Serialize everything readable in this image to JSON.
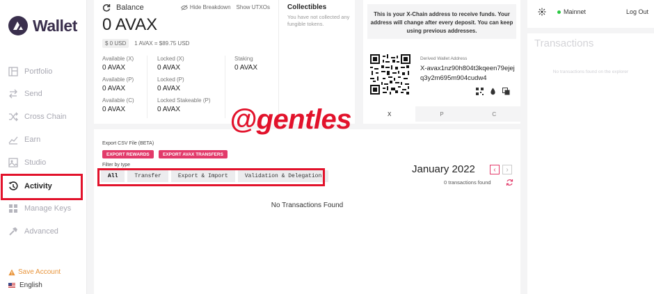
{
  "app": {
    "name": "Wallet"
  },
  "sidebar": {
    "items": [
      {
        "label": "Portfolio",
        "icon": "portfolio-icon"
      },
      {
        "label": "Send",
        "icon": "send-icon"
      },
      {
        "label": "Cross Chain",
        "icon": "cross-chain-icon"
      },
      {
        "label": "Earn",
        "icon": "earn-icon"
      },
      {
        "label": "Studio",
        "icon": "studio-icon"
      },
      {
        "label": "Activity",
        "icon": "activity-icon",
        "active": true
      },
      {
        "label": "Manage Keys",
        "icon": "manage-keys-icon"
      },
      {
        "label": "Advanced",
        "icon": "advanced-icon"
      }
    ],
    "save_account": "Save Account",
    "language": "English"
  },
  "balance": {
    "title": "Balance",
    "hide_breakdown": "Hide Breakdown",
    "show_utxos": "Show UTXOs",
    "amount": "0 AVAX",
    "usd": "$ 0 USD",
    "rate": "1 AVAX = $89.75 USD",
    "stats": [
      {
        "label": "Available (X)",
        "value": "0 AVAX"
      },
      {
        "label": "Available (P)",
        "value": "0 AVAX"
      },
      {
        "label": "Available (C)",
        "value": "0 AVAX"
      },
      {
        "label": "Locked (X)",
        "value": "0 AVAX"
      },
      {
        "label": "Locked (P)",
        "value": "0 AVAX"
      },
      {
        "label": "Locked Stakeable (P)",
        "value": "0 AVAX"
      },
      {
        "label": "Staking",
        "value": "0 AVAX"
      }
    ]
  },
  "collectibles": {
    "title": "Collectibles",
    "text": "You have not collected any fungible tokens."
  },
  "address": {
    "banner": "This is your X-Chain address to receive funds. Your address will change after every deposit. You can keep using previous addresses.",
    "derived_label": "Derived Wallet Address",
    "derived_value": "X-avax1nz90h804t3kqeen79ejejq3y2m695m904cudw4",
    "chains": [
      "X",
      "P",
      "C"
    ],
    "active_chain": "X"
  },
  "transactions": {
    "export_label": "Export CSV File (BETA)",
    "export_rewards": "EXPORT REWARDS",
    "export_avax": "EXPORT AVAX TRANSFERS",
    "filter_label": "Filter by type",
    "filters": [
      "All",
      "Transfer",
      "Export & Import",
      "Validation & Delegation"
    ],
    "active_filter": "All",
    "month": "January 2022",
    "found": "0 transactions found",
    "empty": "No Transactions Found"
  },
  "right_panel": {
    "network": "Mainnet",
    "logout": "Log Out",
    "title": "Transactions",
    "empty": "No transactions found on the explorer"
  },
  "watermark": "@gentles",
  "colors": {
    "accent": "#e23a6a",
    "highlight_red": "#e2122b",
    "warning": "#e8943a",
    "status_green": "#28c840"
  }
}
